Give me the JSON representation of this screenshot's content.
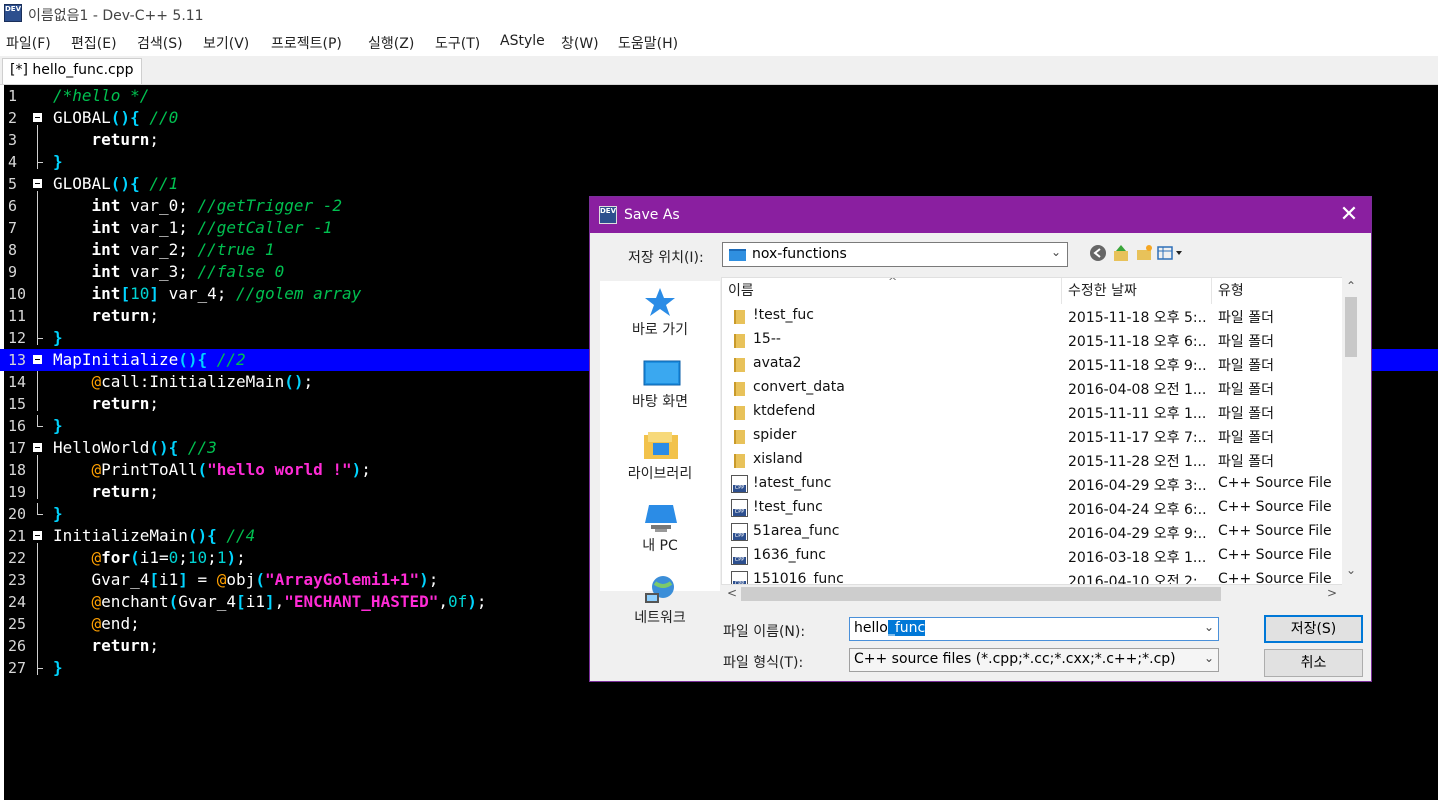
{
  "window": {
    "title": "이름없음1 - Dev-C++ 5.11",
    "app_icon_text": "DEV"
  },
  "menu": [
    "파일(F)",
    "편집(E)",
    "검색(S)",
    "보기(V)",
    "프로젝트(P)",
    "실행(Z)",
    "도구(T)",
    "AStyle",
    "창(W)",
    "도움말(H)"
  ],
  "tab": {
    "label": "[*] hello_func.cpp"
  },
  "editor": {
    "line_numbers": [
      "1",
      "2",
      "3",
      "4",
      "5",
      "6",
      "7",
      "8",
      "9",
      "10",
      "11",
      "12",
      "13",
      "14",
      "15",
      "16",
      "17",
      "18",
      "19",
      "20",
      "21",
      "22",
      "23",
      "24",
      "25",
      "26",
      "27"
    ],
    "highlighted_line": 13
  },
  "dialog": {
    "title": "Save As",
    "icon_text": "DEV",
    "close_glyph": "✕",
    "location_label": "저장 위치(I):",
    "location_value": "nox-functions",
    "places": [
      "바로 가기",
      "바탕 화면",
      "라이브러리",
      "내 PC",
      "네트워크"
    ],
    "columns": {
      "name": "이름",
      "modified": "수정한 날짜",
      "type": "유형"
    },
    "files": [
      {
        "name": "!test_fuc",
        "modified": "2015-11-18 오후 5:...",
        "type": "파일 폴더",
        "kind": "folder"
      },
      {
        "name": "15--",
        "modified": "2015-11-18 오후 6:...",
        "type": "파일 폴더",
        "kind": "folder"
      },
      {
        "name": "avata2",
        "modified": "2015-11-18 오후 9:...",
        "type": "파일 폴더",
        "kind": "folder"
      },
      {
        "name": "convert_data",
        "modified": "2016-04-08 오전 1...",
        "type": "파일 폴더",
        "kind": "folder"
      },
      {
        "name": "ktdefend",
        "modified": "2015-11-11 오후 1...",
        "type": "파일 폴더",
        "kind": "folder"
      },
      {
        "name": "spider",
        "modified": "2015-11-17 오후 7:...",
        "type": "파일 폴더",
        "kind": "folder"
      },
      {
        "name": "xisland",
        "modified": "2015-11-28 오전 1...",
        "type": "파일 폴더",
        "kind": "folder"
      },
      {
        "name": "!atest_func",
        "modified": "2016-04-29 오후 3:...",
        "type": "C++ Source File",
        "kind": "cpp"
      },
      {
        "name": "!test_func",
        "modified": "2016-04-24 오후 6:...",
        "type": "C++ Source File",
        "kind": "cpp"
      },
      {
        "name": "51area_func",
        "modified": "2016-04-29 오후 9:...",
        "type": "C++ Source File",
        "kind": "cpp"
      },
      {
        "name": "1636_func",
        "modified": "2016-03-18 오후 1...",
        "type": "C++ Source File",
        "kind": "cpp"
      },
      {
        "name": "151016_func",
        "modified": "2016-04-10 오전 2:...",
        "type": "C++ Source File",
        "kind": "cpp"
      }
    ],
    "filename_label": "파일 이름(N):",
    "filename_value_plain": "hello",
    "filename_value_selected": "_func",
    "filetype_label": "파일 형식(T):",
    "filetype_value": "C++ source files (*.cpp;*.cc;*.cxx;*.c++;*.cp)",
    "save_label": "저장(S)",
    "cancel_label": "취소"
  },
  "colors": {
    "title_bar": "#8a1fa0",
    "highlight": "#0000ff",
    "accent": "#0078d7"
  }
}
